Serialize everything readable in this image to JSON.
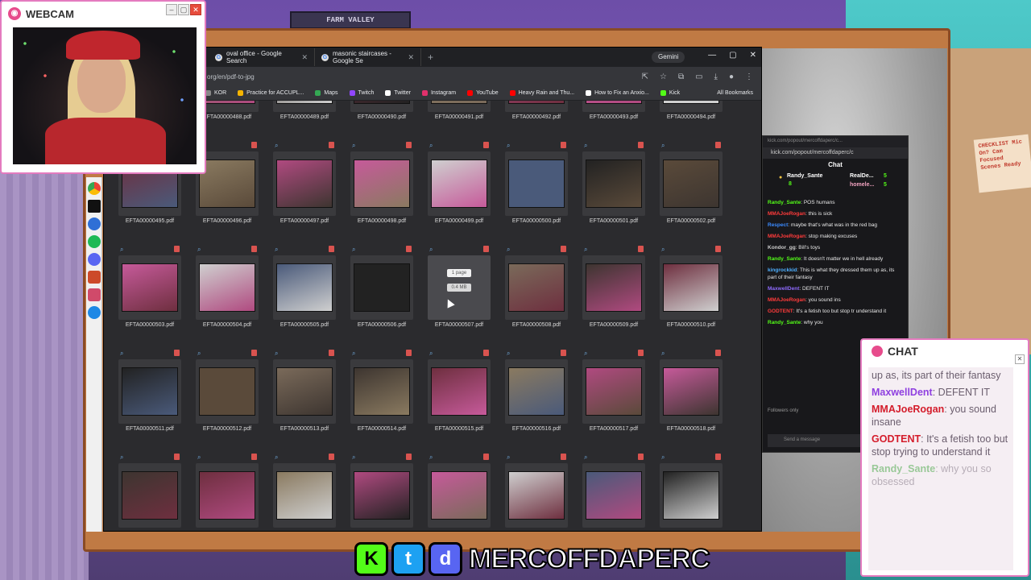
{
  "scene": {
    "shelf_text": "FARM VALLEY",
    "note_text": "CHECKLIST Mic On? Cam Focused Scenes Ready"
  },
  "webcam": {
    "title": "WEBCAM"
  },
  "browser": {
    "tabs": [
      {
        "label": "oval office - Google Search"
      },
      {
        "label": "masonic staircases - Google Se"
      }
    ],
    "gemini": "Gemini",
    "url": "org/en/pdf-to-jpg",
    "bookmarks": [
      {
        "label": "KOR",
        "color": "#888888"
      },
      {
        "label": "Practice for ACCUPL...",
        "color": "#f4b400"
      },
      {
        "label": "Maps",
        "color": "#34a853"
      },
      {
        "label": "Twitch",
        "color": "#9146ff"
      },
      {
        "label": "Twitter",
        "color": "#ffffff"
      },
      {
        "label": "Instagram",
        "color": "#e1306c"
      },
      {
        "label": "YouTube",
        "color": "#ff0000"
      },
      {
        "label": "Heavy Rain and Thu...",
        "color": "#ff0000"
      },
      {
        "label": "How to Fix an Anxio...",
        "color": "#ffffff"
      },
      {
        "label": "Kick",
        "color": "#53fc18"
      }
    ],
    "all_bookmarks": "All Bookmarks"
  },
  "files": {
    "row1": [
      "EFTA00000488.pdf",
      "EFTA00000489.pdf",
      "EFTA00000490.pdf",
      "EFTA00000491.pdf",
      "EFTA00000492.pdf",
      "EFTA00000493.pdf",
      "EFTA00000494.pdf"
    ],
    "row2": [
      "EFTA00000495.pdf",
      "EFTA00000496.pdf",
      "EFTA00000497.pdf",
      "EFTA00000498.pdf",
      "EFTA00000499.pdf",
      "EFTA00000500.pdf",
      "EFTA00000501.pdf",
      "EFTA00000502.pdf"
    ],
    "row3": [
      "EFTA00000503.pdf",
      "EFTA00000504.pdf",
      "EFTA00000505.pdf",
      "EFTA00000506.pdf",
      "EFTA00000507.pdf",
      "EFTA00000508.pdf",
      "EFTA00000509.pdf",
      "EFTA00000510.pdf"
    ],
    "row4": [
      "EFTA00000511.pdf",
      "EFTA00000512.pdf",
      "EFTA00000513.pdf",
      "EFTA00000514.pdf",
      "EFTA00000515.pdf",
      "EFTA00000516.pdf",
      "EFTA00000517.pdf",
      "EFTA00000518.pdf"
    ],
    "hover": {
      "pages": "1 page",
      "size": "0.4 MB"
    }
  },
  "kick": {
    "window_title": "kick.com/popout/mercoffdaperc/c...",
    "url": "kick.com/popout/mercoffdaperc/c",
    "header": "Chat",
    "pinned": [
      {
        "name": "Randy_Sante",
        "count": "8"
      },
      {
        "name": "RealDe...",
        "count": "5"
      },
      {
        "name": "homele...",
        "count": "5"
      }
    ],
    "messages": [
      {
        "user": "Randy_Sante",
        "text": "POS humans",
        "color": "#53fc18"
      },
      {
        "user": "MMAJoeRogan",
        "text": "this is sick",
        "color": "#ff3b3b"
      },
      {
        "user": "Respect",
        "text": "maybe that's what was in the red bag",
        "color": "#3b8bff"
      },
      {
        "user": "MMAJoeRogan",
        "text": "stop making excuses",
        "color": "#ff3b3b"
      },
      {
        "user": "Kondor_gg",
        "text": "Bill's toys",
        "color": "#cccccc"
      },
      {
        "user": "Randy_Sante",
        "text": "It doesn't matter we in hell already",
        "color": "#53fc18"
      },
      {
        "user": "kingrockkid",
        "text": "This is what they dressed them up as, its part of their fantasy",
        "color": "#4fb0ff"
      },
      {
        "user": "MaxwellDent",
        "text": "DEFENT IT",
        "color": "#8f6bff"
      },
      {
        "user": "MMAJoeRogan",
        "text": "you sound ins",
        "color": "#ff3b3b"
      },
      {
        "user": "GODTENT",
        "text": "It's a fetish too but stop tr understand it",
        "color": "#ff3b3b"
      },
      {
        "user": "Randy_Sante",
        "text": "why you",
        "color": "#53fc18"
      }
    ],
    "followers_only": "Followers only",
    "send_placeholder": "Send a message"
  },
  "chat_overlay": {
    "title": "CHAT",
    "messages": [
      {
        "user": "",
        "text": "up as, its part of their fantasy",
        "color": "#6b5e6e"
      },
      {
        "user": "MaxwellDent",
        "text": "DEFENT IT",
        "color": "#8f3fe0"
      },
      {
        "user": "MMAJoeRogan",
        "text": "you sound insane",
        "color": "#d41c2b"
      },
      {
        "user": "GODTENT",
        "text": "It's a fetish too but stop trying to understand it",
        "color": "#d41c2b"
      },
      {
        "user": "Randy_Sante",
        "text": "why you so obsessed",
        "color": "#2a9c2a"
      }
    ]
  },
  "branding": {
    "name": "MERCOFFDAPERC"
  }
}
